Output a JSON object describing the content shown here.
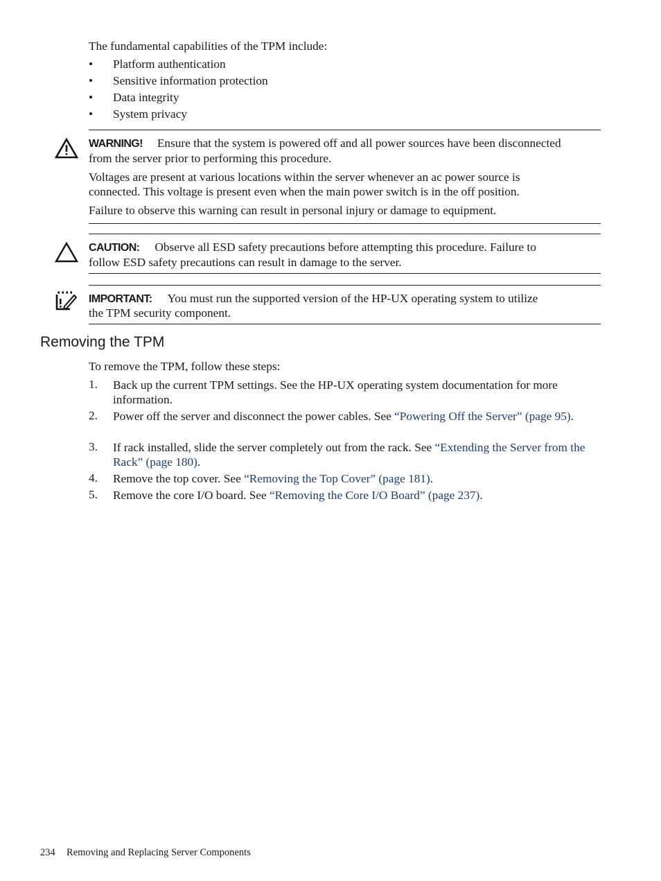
{
  "intro": "The fundamental capabilities of the TPM include:",
  "capabilities": [
    "Platform authentication",
    "Sensitive information protection",
    "Data integrity",
    "System privacy"
  ],
  "bullet_glyph": "•",
  "warning": {
    "icon": "warning-triangle-icon",
    "label": "WARNING!",
    "line1": "Ensure that the system is powered off and all power sources have been disconnected",
    "line2": "from the server prior to performing this procedure.",
    "para2_line1": "Voltages are present at various locations within the server whenever an ac power source is",
    "para2_line2": "connected. This voltage is present even when the main power switch is in the off position.",
    "para3": "Failure to observe this warning can result in personal injury or damage to equipment."
  },
  "caution": {
    "icon": "caution-triangle-icon",
    "label": "CAUTION:",
    "line1": "Observe all ESD safety precautions before attempting this procedure. Failure to",
    "line2": "follow ESD safety precautions can result in damage to the server."
  },
  "important": {
    "icon": "notepad-pencil-icon",
    "label": "IMPORTANT:",
    "line1": "You must run the supported version of the HP-UX operating system to utilize",
    "line2": "the TPM security component."
  },
  "section_title": "Removing the TPM",
  "steps_intro": "To remove the TPM, follow these steps:",
  "steps": [
    {
      "num": "1.",
      "text": "Back up the current TPM settings. See the HP-UX operating system documentation for more information.",
      "link": "",
      "after": ""
    },
    {
      "num": "2.",
      "text": "Power off the server and disconnect the power cables. See ",
      "link": "“Powering Off the Server” (page 95)",
      "after": "."
    },
    {
      "num": "3.",
      "text": "If rack installed, slide the server completely out from the rack. See ",
      "link": "“Extending the Server from the Rack” (page 180)",
      "after": "."
    },
    {
      "num": "4.",
      "text": "Remove the top cover. See ",
      "link": "“Removing the Top Cover” (page 181)",
      "after": "."
    },
    {
      "num": "5.",
      "text": "Remove the core I/O board. See ",
      "link": "“Removing the Core I/O Board” (page 237)",
      "after": "."
    }
  ],
  "footer": {
    "page_number": "234",
    "chapter": "Removing and Replacing Server Components"
  },
  "colors": {
    "link": "#1f3f6e",
    "text": "#1a1a1a"
  }
}
